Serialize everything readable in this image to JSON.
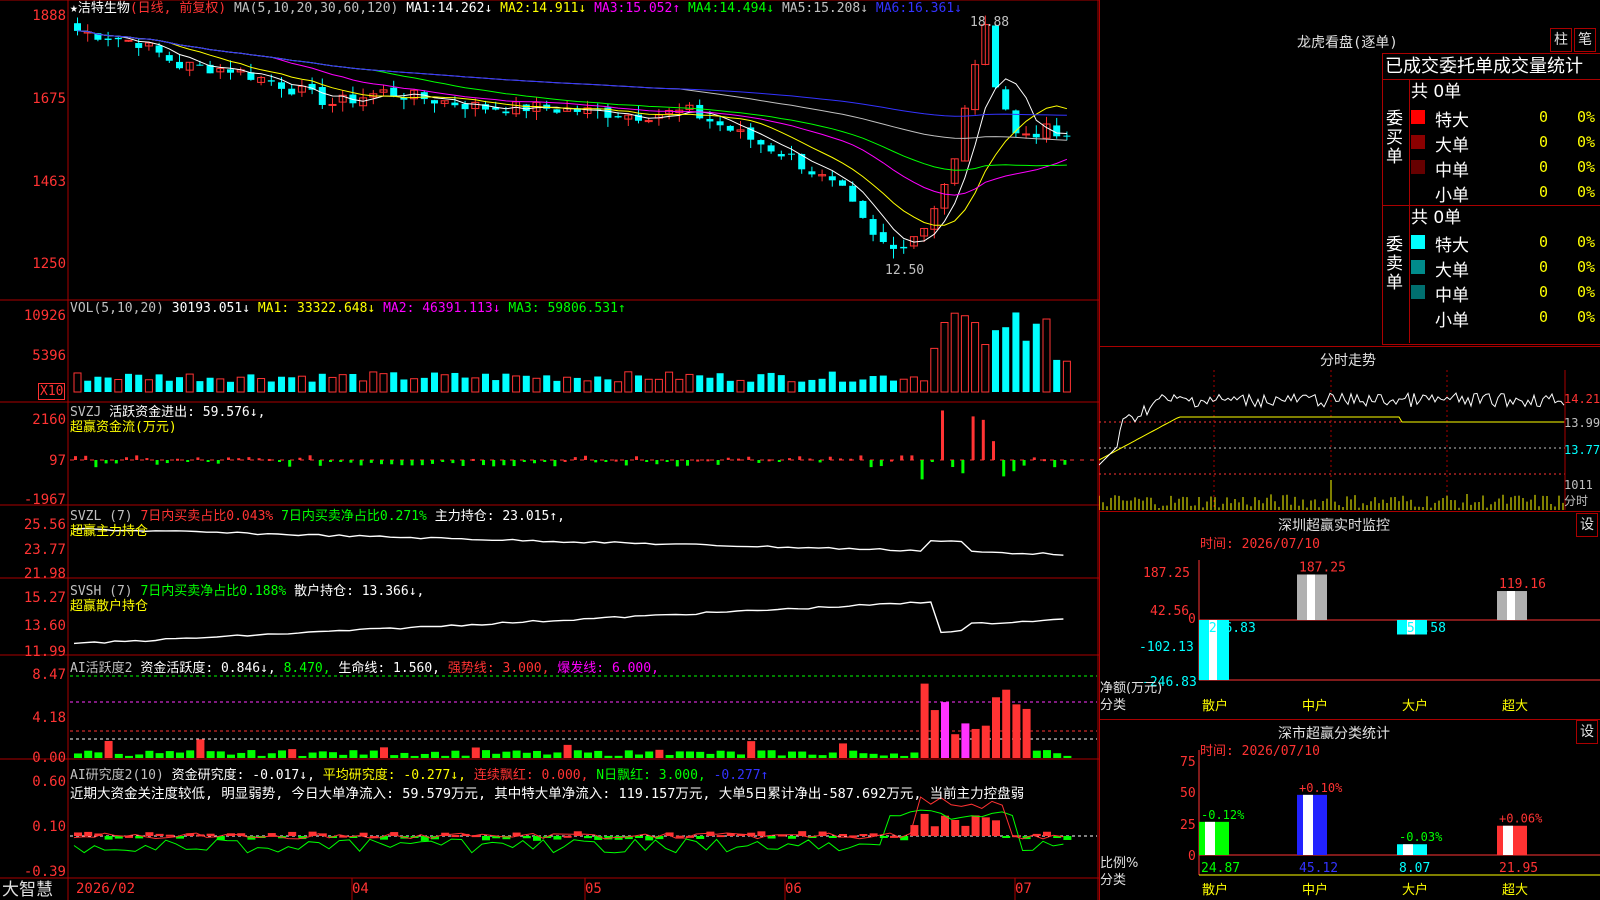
{
  "app": {
    "name": "大智慧"
  },
  "header": {
    "star": "★",
    "stock": "洁特生物",
    "mode": "(日线, 前复权)",
    "ma_label": "MA(5,10,20,30,60,120)",
    "ma": [
      {
        "name": "MA1:",
        "value": "14.262↓",
        "color": "#ffffff"
      },
      {
        "name": "MA2:",
        "value": "14.911↓",
        "color": "#ffff00"
      },
      {
        "name": "MA3:",
        "value": "15.052↑",
        "color": "#ff00ff"
      },
      {
        "name": "MA4:",
        "value": "14.494↓",
        "color": "#00ff00"
      },
      {
        "name": "MA5:",
        "value": "15.208↓",
        "color": "#c0c0c0"
      },
      {
        "name": "MA6:",
        "value": "16.361↓",
        "color": "#3333ff"
      }
    ]
  },
  "price_axis": [
    "1888",
    "1675",
    "1463",
    "1250"
  ],
  "price_annotations": {
    "high": "18.88",
    "low": "12.50"
  },
  "vol": {
    "label": "VOL(5,10,20)",
    "value": "30193.051↓",
    "ma1": "MA1: 33322.648↓",
    "ma2": "MA2: 46391.113↓",
    "ma3": "MA3: 59806.531↑",
    "axis": [
      "10926",
      "5396"
    ],
    "unit": "X10"
  },
  "svzj": {
    "label": "SVZJ",
    "item": "活跃资金进出: 59.576↓,",
    "sub": "超赢资金流(万元)",
    "axis": [
      "2160",
      "97",
      "-1967"
    ]
  },
  "svzl": {
    "label": "SVZL (7)",
    "t1": "7日内买卖占比0.043%",
    "t2": "7日内买卖净占比0.271%",
    "t3": "主力持仓: 23.015↑,",
    "sub": "超赢主力持仓",
    "axis": [
      "25.56",
      "23.77",
      "21.98"
    ]
  },
  "svsh": {
    "label": "SVSH (7)",
    "t1": "7日内买卖净占比0.188%",
    "t2": "散户持仓: 13.366↓,",
    "sub": "超赢散户持仓",
    "axis": [
      "15.27",
      "13.60",
      "11.99"
    ]
  },
  "ai_active": {
    "label": "AI活跃度2",
    "t1": "资金活跃度: 0.846↓,",
    "t2": "8.470,",
    "t3": "生命线: 1.560,",
    "t4": "强势线: 3.000,",
    "t5": "爆发线: 6.000,",
    "axis": [
      "8.47",
      "4.18",
      "0.00"
    ]
  },
  "ai_research": {
    "label": "AI研究度2(10)",
    "t1": "资金研究度: -0.017↓,",
    "t2": "平均研究度: -0.277↓,",
    "t3": "连续飘红: 0.000,",
    "t4": "N日飘红: 3.000,",
    "t5": "-0.277↑",
    "note": "近期大资金关注度较低, 明显弱势, 今日大单净流入: 59.579万元, 其中特大单净流入: 119.157万元, 大单5日累计净出-587.692万元, 当前主力控盘弱",
    "axis": [
      "0.60",
      "0.10",
      "-0.39"
    ]
  },
  "date_axis": [
    "2026/02",
    "04",
    "05",
    "06",
    "07"
  ],
  "dragon": {
    "title": "龙虎看盘(逐单)",
    "btn1": "柱",
    "btn2": "笔",
    "header": "已成交委托单成交量统计",
    "buy_label": "委买单",
    "sell_label": "委卖单",
    "buy_total": "共 0单",
    "sell_total": "共 0单",
    "buy_rows": [
      {
        "name": "特大",
        "n": "0",
        "p": "0%",
        "color": "#ff0000"
      },
      {
        "name": "大单",
        "n": "0",
        "p": "0%",
        "color": "#8b0000"
      },
      {
        "name": "中单",
        "n": "0",
        "p": "0%",
        "color": "#660000"
      },
      {
        "name": "小单",
        "n": "0",
        "p": "0%",
        "color": "#000000"
      }
    ],
    "sell_rows": [
      {
        "name": "特大",
        "n": "0",
        "p": "0%",
        "color": "#00ffff"
      },
      {
        "name": "大单",
        "n": "0",
        "p": "0%",
        "color": "#008b8b"
      },
      {
        "name": "中单",
        "n": "0",
        "p": "0%",
        "color": "#006f6f"
      },
      {
        "name": "小单",
        "n": "0",
        "p": "0%",
        "color": "#000000"
      }
    ]
  },
  "intraday": {
    "title": "分时走势",
    "axis": [
      "14.21",
      "13.99",
      "13.77",
      "1011",
      "分时"
    ]
  },
  "monitor": {
    "title": "深圳超赢实时监控",
    "btn": "设",
    "time": "时间: 2026/07/10",
    "axis": [
      "187.25",
      "42.56",
      "0",
      "-102.13",
      "-246.83"
    ],
    "ylabel": "净额(万元)",
    "xlabel": "分类",
    "categories": [
      "散户",
      "中户",
      "大户",
      "超大"
    ]
  },
  "classify": {
    "title": "深市超赢分类统计",
    "btn": "设",
    "time": "时间: 2026/07/10",
    "axis": [
      "75",
      "50",
      "25",
      "0"
    ],
    "ylabel": "比例%",
    "xlabel": "分类",
    "categories": [
      "散户",
      "中户",
      "大户",
      "超大"
    ],
    "values": [
      "24.87",
      "45.12",
      "8.07",
      "21.95"
    ],
    "changes": [
      "-0.12%",
      "+0.10%",
      "-0.03%",
      "+0.06%"
    ]
  },
  "chart_data": [
    {
      "type": "candlestick",
      "title": "洁特生物 (日线, 前复权)",
      "ylim": [
        12.5,
        18.88
      ],
      "x_range": [
        "2026/02",
        "2026/07"
      ],
      "recent_high": 18.88,
      "recent_low": 12.5
    },
    {
      "type": "bar",
      "title": "深圳超赢实时监控",
      "categories": [
        "散户",
        "中户",
        "大户",
        "超大"
      ],
      "values": [
        -246.83,
        187.25,
        -59.58,
        119.16
      ],
      "ylim": [
        -246.83,
        187.25
      ],
      "ylabel": "净额(万元)",
      "xlabel": "分类"
    },
    {
      "type": "bar",
      "title": "深市超赢分类统计",
      "categories": [
        "散户",
        "中户",
        "大户",
        "超大"
      ],
      "values": [
        24.87,
        45.12,
        8.07,
        21.95
      ],
      "changes": [
        "-0.12%",
        "+0.10%",
        "-0.03%",
        "+0.06%"
      ],
      "ylim": [
        0,
        75
      ],
      "ylabel": "比例%",
      "xlabel": "分类"
    }
  ]
}
